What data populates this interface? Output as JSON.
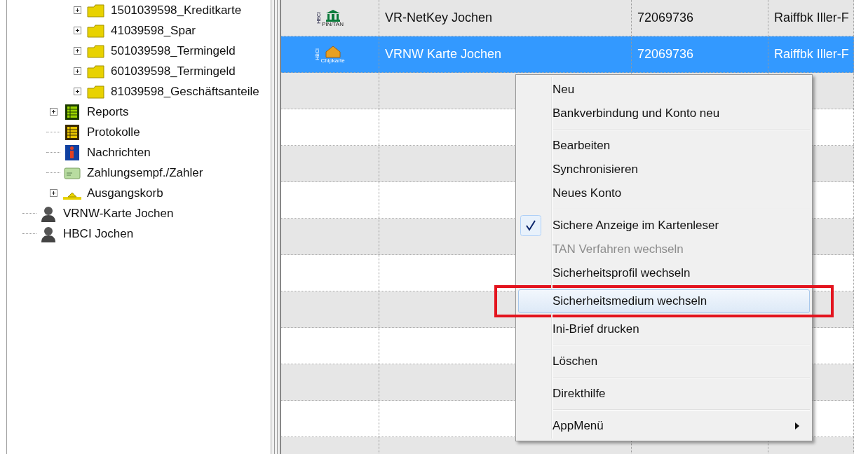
{
  "tree": [
    {
      "children": [
        {
          "children": [
            {
              "label": "1501039598_Kreditkarte",
              "kind": "folder",
              "expandable": true
            },
            {
              "label": "41039598_Spar",
              "kind": "folder",
              "expandable": true
            },
            {
              "label": "501039598_Termingeld",
              "kind": "folder",
              "expandable": true
            },
            {
              "label": "601039598_Termingeld",
              "kind": "folder",
              "expandable": true
            },
            {
              "label": "81039598_Geschäftsanteile",
              "kind": "folder",
              "expandable": true
            }
          ]
        },
        {
          "label": "Reports",
          "kind": "reports",
          "expandable": true
        },
        {
          "label": "Protokolle",
          "kind": "log",
          "expandable": false
        },
        {
          "label": "Nachrichten",
          "kind": "messages",
          "expandable": false
        },
        {
          "label": "Zahlungsempf./Zahler",
          "kind": "payee",
          "expandable": false
        },
        {
          "label": "Ausgangskorb",
          "kind": "outbox",
          "expandable": true
        }
      ]
    },
    {
      "label": "VRNW-Karte Jochen",
      "kind": "user",
      "expandable": false
    },
    {
      "label": "HBCI Jochen",
      "kind": "user",
      "expandable": false
    }
  ],
  "table": {
    "rows": [
      {
        "kind": "bank",
        "icon_tag": "HBCI",
        "icon_caption": "PIN/TAN",
        "name": "VR-NetKey Jochen",
        "number": "72069736",
        "bank": "Raiffbk Iller-F",
        "selected": false
      },
      {
        "kind": "card",
        "icon_tag": "HBCI",
        "icon_caption": "Chipkarte",
        "name": "VRNW Karte Jochen",
        "number": "72069736",
        "bank": "Raiffbk Iller-F",
        "selected": true
      }
    ]
  },
  "context_menu": {
    "items": [
      {
        "kind": "item",
        "label": "Neu",
        "checked": false,
        "disabled": false,
        "selected": false
      },
      {
        "kind": "item",
        "label": "Bankverbindung und Konto neu",
        "checked": false,
        "disabled": false,
        "selected": false
      },
      {
        "kind": "separator"
      },
      {
        "kind": "item",
        "label": "Bearbeiten",
        "checked": false,
        "disabled": false,
        "selected": false
      },
      {
        "kind": "item",
        "label": "Synchronisieren",
        "checked": false,
        "disabled": false,
        "selected": false
      },
      {
        "kind": "item",
        "label": "Neues Konto",
        "checked": false,
        "disabled": false,
        "selected": false
      },
      {
        "kind": "separator"
      },
      {
        "kind": "item",
        "label": "Sichere Anzeige im Kartenleser",
        "checked": true,
        "disabled": false,
        "selected": false
      },
      {
        "kind": "item",
        "label": "TAN Verfahren wechseln",
        "checked": false,
        "disabled": true,
        "selected": false
      },
      {
        "kind": "item",
        "label": "Sicherheitsprofil wechseln",
        "checked": false,
        "disabled": false,
        "selected": false
      },
      {
        "kind": "item",
        "label": "Sicherheitsmedium wechseln",
        "checked": false,
        "disabled": false,
        "selected": true,
        "highlight_frame": true
      },
      {
        "kind": "item",
        "label": "Ini-Brief drucken",
        "checked": false,
        "disabled": false,
        "selected": false
      },
      {
        "kind": "separator"
      },
      {
        "kind": "item",
        "label": "Löschen",
        "checked": false,
        "disabled": false,
        "selected": false
      },
      {
        "kind": "separator"
      },
      {
        "kind": "item",
        "label": "Direkthilfe",
        "checked": false,
        "disabled": false,
        "selected": false
      },
      {
        "kind": "separator"
      },
      {
        "kind": "submenu",
        "label": "AppMenü",
        "checked": false,
        "disabled": false,
        "selected": false
      }
    ]
  }
}
